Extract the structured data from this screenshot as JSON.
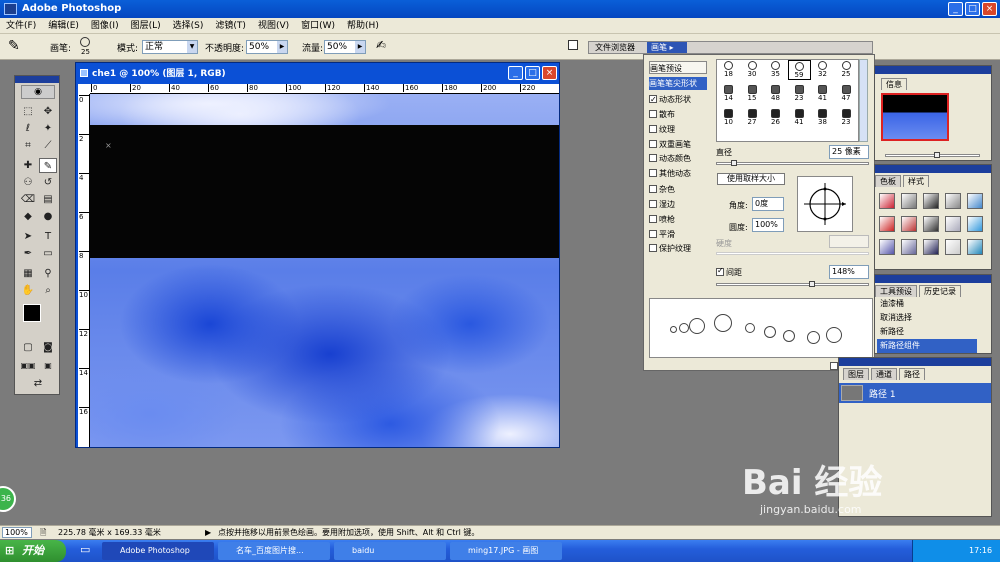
{
  "app": {
    "title": "Adobe Photoshop"
  },
  "menu": [
    "文件(F)",
    "编辑(E)",
    "图像(I)",
    "图层(L)",
    "选择(S)",
    "滤镜(T)",
    "视图(V)",
    "窗口(W)",
    "帮助(H)"
  ],
  "options": {
    "brush_label": "画笔:",
    "brush_size": "25",
    "mode_label": "模式:",
    "mode_value": "正常",
    "opacity_label": "不透明度:",
    "opacity_value": "50%",
    "flow_label": "流量:",
    "flow_value": "50%"
  },
  "well": {
    "tab1": "文件浏览器",
    "tab2": "画笔"
  },
  "document": {
    "title": "che1 @ 100% (图层 1, RGB)",
    "ruler_marks": [
      "0",
      "20",
      "40",
      "60",
      "80",
      "100",
      "120",
      "140",
      "160",
      "180",
      "200",
      "220"
    ],
    "ruler_v_marks": [
      "0",
      "2",
      "4",
      "6",
      "8",
      "10",
      "12",
      "14",
      "16"
    ]
  },
  "brush_panel": {
    "items": [
      {
        "label": "画笔预设",
        "checkbox": false,
        "checked": false,
        "selected": false
      },
      {
        "label": "画笔笔尖形状",
        "checkbox": false,
        "checked": false,
        "selected": true
      },
      {
        "label": "动态形状",
        "checkbox": true,
        "checked": true,
        "selected": false
      },
      {
        "label": "散布",
        "checkbox": true,
        "checked": false,
        "selected": false
      },
      {
        "label": "纹理",
        "checkbox": true,
        "checked": false,
        "selected": false
      },
      {
        "label": "双重画笔",
        "checkbox": true,
        "checked": false,
        "selected": false
      },
      {
        "label": "动态颜色",
        "checkbox": true,
        "checked": false,
        "selected": false
      },
      {
        "label": "其他动态",
        "checkbox": true,
        "checked": false,
        "selected": false
      },
      {
        "label": "杂色",
        "checkbox": true,
        "checked": false,
        "selected": false
      },
      {
        "label": "湿边",
        "checkbox": true,
        "checked": false,
        "selected": false
      },
      {
        "label": "喷枪",
        "checkbox": true,
        "checked": false,
        "selected": false
      },
      {
        "label": "平滑",
        "checkbox": true,
        "checked": false,
        "selected": false
      },
      {
        "label": "保护纹理",
        "checkbox": true,
        "checked": false,
        "selected": false
      }
    ],
    "presets_row1": [
      "18",
      "30",
      "35",
      "59",
      "32",
      "25"
    ],
    "presets_row2": [
      "14",
      "15",
      "48",
      "23",
      "41",
      "47"
    ],
    "presets_row3": [
      "10",
      "27",
      "26",
      "41",
      "38",
      "23"
    ],
    "diameter_label": "直径",
    "diameter_value": "25 像素",
    "use_sample_label": "使用取样大小",
    "angle_label": "角度:",
    "angle_value": "0度",
    "roundness_label": "圆度:",
    "roundness_value": "100%",
    "hardness_label": "硬度",
    "spacing_label": "间距",
    "spacing_value": "148%"
  },
  "navigator": {
    "tab": "信息"
  },
  "styles": {
    "tab1": "色板",
    "tab2": "样式"
  },
  "history": {
    "tab1": "工具预设",
    "tab2": "历史记录",
    "items": [
      "油漆桶",
      "取消选择",
      "新路径",
      "新路径组件"
    ]
  },
  "paths": {
    "tab1": "图层",
    "tab2": "通道",
    "tab3": "路径",
    "item": "路径 1"
  },
  "status": {
    "zoom": "100%",
    "size": "225.78 毫米 x 169.33 毫米",
    "hint": "点按并拖移以用前景色绘画。要用附加选项，使用 Shift、Alt 和 Ctrl 键。"
  },
  "taskbar": {
    "start": "开始",
    "items": [
      "Adobe Photoshop",
      "名车_百度图片搜...",
      "baidu",
      "ming17.JPG - 画图"
    ],
    "time": "17:16"
  },
  "watermark": {
    "text": "Bai 经验",
    "url": "jingyan.baidu.com"
  },
  "badge": "36"
}
